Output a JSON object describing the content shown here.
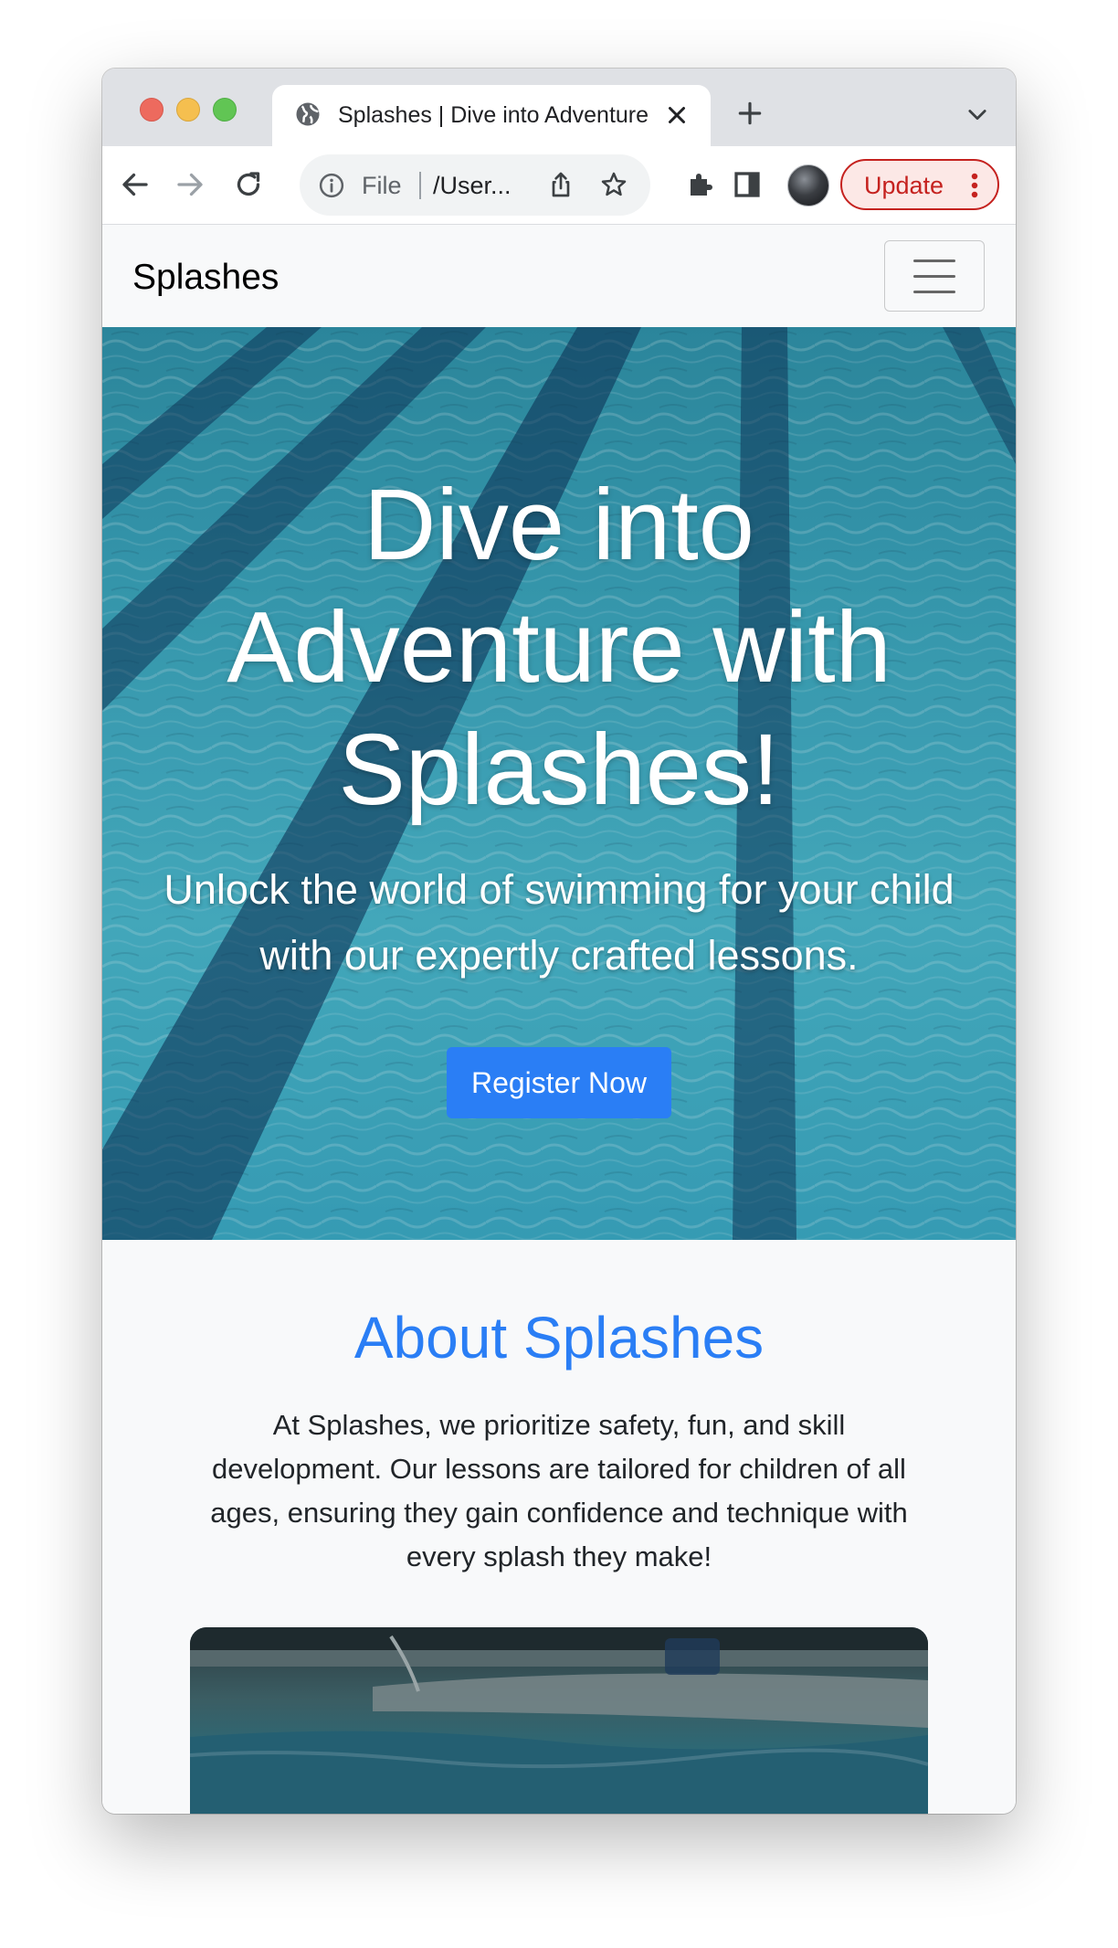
{
  "browser": {
    "tab_title": "Splashes | Dive into Adventure",
    "address_scheme": "File",
    "address_url": "/User...",
    "update_label": "Update"
  },
  "navbar": {
    "brand": "Splashes"
  },
  "hero": {
    "title": "Dive into Adventure with Splashes!",
    "subtitle": "Unlock the world of swimming for your child with our expertly crafted lessons.",
    "cta_label": "Register Now"
  },
  "about": {
    "title": "About Splashes",
    "text": "At Splashes, we prioritize safety, fun, and skill development. Our lessons are tailored for children of all ages, ensuring they gain confidence and technique with every splash they make!"
  },
  "icons": {
    "tab_favicon": "globe-icon",
    "tab_close": "close-icon",
    "new_tab": "plus-icon",
    "tab_menu": "chevron-down-icon",
    "back": "arrow-left-icon",
    "forward": "arrow-right-icon",
    "reload": "reload-icon",
    "site_info": "info-icon",
    "share": "share-icon",
    "bookmark": "star-icon",
    "extensions": "puzzle-icon",
    "side_panel": "side-panel-icon",
    "menu": "more-vertical-icon",
    "navbar_toggle": "hamburger-icon"
  },
  "colors": {
    "accent": "#2a7ef5",
    "update": "#c5221f",
    "page_bg": "#f8f9fa"
  }
}
